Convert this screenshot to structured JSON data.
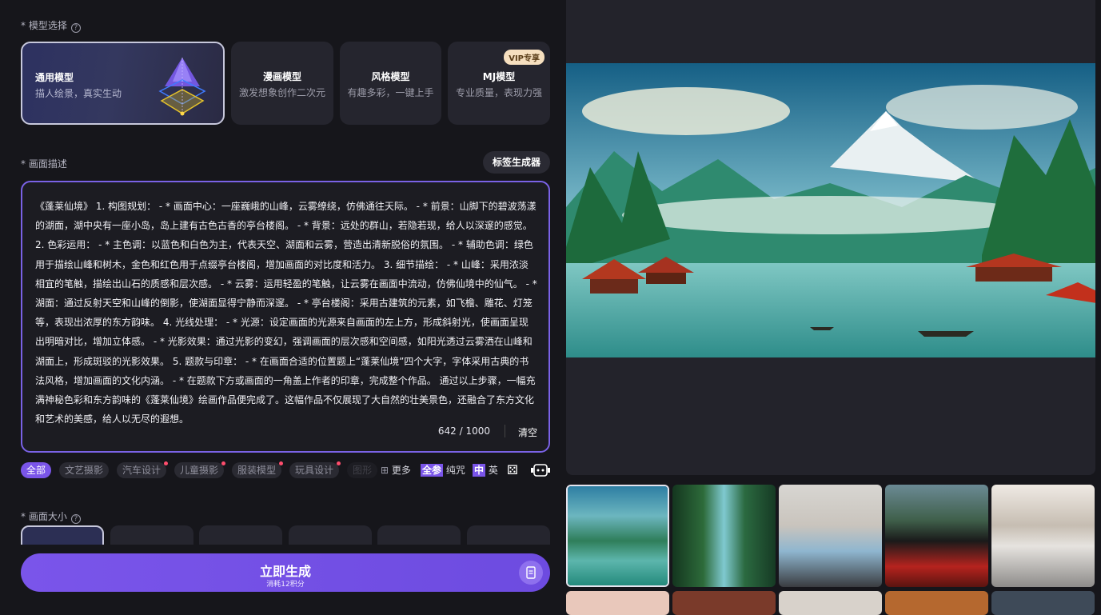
{
  "model_section": {
    "label": "* 模型选择"
  },
  "models": [
    {
      "title": "通用模型",
      "subtitle": "描人绘景，真实生动"
    },
    {
      "title": "漫画模型",
      "subtitle": "激发想象创作二次元"
    },
    {
      "title": "风格模型",
      "subtitle": "有趣多彩，一键上手"
    },
    {
      "title": "MJ模型",
      "subtitle": "专业质量，表现力强",
      "badge": "VIP专享"
    }
  ],
  "description": {
    "label": "* 画面描述",
    "tag_button": "标签生成器",
    "text": "《蓬莱仙境》 1. 构图规划： - * 画面中心：一座巍峨的山峰，云雾缭绕，仿佛通往天际。 - * 前景：山脚下的碧波荡漾的湖面，湖中央有一座小岛，岛上建有古色古香的亭台楼阁。 - * 背景：远处的群山，若隐若现，给人以深邃的感觉。 2. 色彩运用： - * 主色调：以蓝色和白色为主，代表天空、湖面和云雾，营造出清新脱俗的氛围。 - * 辅助色调：绿色用于描绘山峰和树木，金色和红色用于点缀亭台楼阁，增加画面的对比度和活力。 3. 细节描绘： - * 山峰：采用浓淡相宜的笔触，描绘出山石的质感和层次感。 - * 云雾：运用轻盈的笔触，让云雾在画面中流动，仿佛仙境中的仙气。 - * 湖面：通过反射天空和山峰的倒影，使湖面显得宁静而深邃。 - * 亭台楼阁：采用古建筑的元素，如飞檐、雕花、灯笼等，表现出浓厚的东方韵味。 4. 光线处理： - * 光源：设定画面的光源来自画面的左上方，形成斜射光，使画面呈现出明暗对比，增加立体感。 - * 光影效果：通过光影的变幻，强调画面的层次感和空间感，如阳光透过云雾洒在山峰和湖面上，形成斑驳的光影效果。 5. 题款与印章： - * 在画面合适的位置题上“蓬莱仙境”四个大字，字体采用古典的书法风格，增加画面的文化内涵。 - * 在题款下方或画面的一角盖上作者的印章，完成整个作品。 通过以上步骤，一幅充满神秘色彩和东方韵味的《蓬莱仙境》绘画作品便完成了。这幅作品不仅展现了大自然的壮美景色，还融合了东方文化和艺术的美感，给人以无尽的遐想。",
    "counter": "642 / 1000",
    "clear": "清空"
  },
  "style_chips": [
    "全部",
    "文艺摄影",
    "汽车设计",
    "儿童摄影",
    "服装模型",
    "玩具设计",
    "图形"
  ],
  "tools": {
    "more": "更多",
    "full_badge": "全参",
    "full_label": "纯咒",
    "lang_badge": "中",
    "lang_label": "英"
  },
  "size_section": {
    "label": "* 画面大小"
  },
  "generate": {
    "label": "立即生成",
    "cost": "消耗12积分"
  },
  "colors": {
    "accent": "#7a55e9",
    "background": "#16161b",
    "card": "#25252e"
  }
}
